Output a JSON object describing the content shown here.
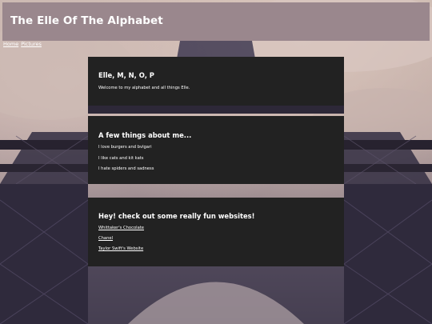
{
  "header": {
    "title": "The Elle Of The Alphabet"
  },
  "nav": {
    "items": [
      "Home",
      "Pictures"
    ]
  },
  "cards": {
    "intro": {
      "heading": "Elle, M, N, O, P",
      "text": "Welcome to my alphabet and all things Elle."
    },
    "about": {
      "heading": "A few things about me...",
      "lines": [
        "I love burgers and bvlgari",
        "I like cats and kit kats",
        "I hate spiders and sadness"
      ]
    },
    "websites": {
      "heading": "Hey! check out some really fun websites!",
      "links": [
        "Whittaker's Chocolate",
        "Chanel",
        "Taylor Swift's Website"
      ]
    }
  },
  "colors": {
    "title_bar": "#9a878d",
    "card_bg": "#222222",
    "text": "#ffffff"
  }
}
